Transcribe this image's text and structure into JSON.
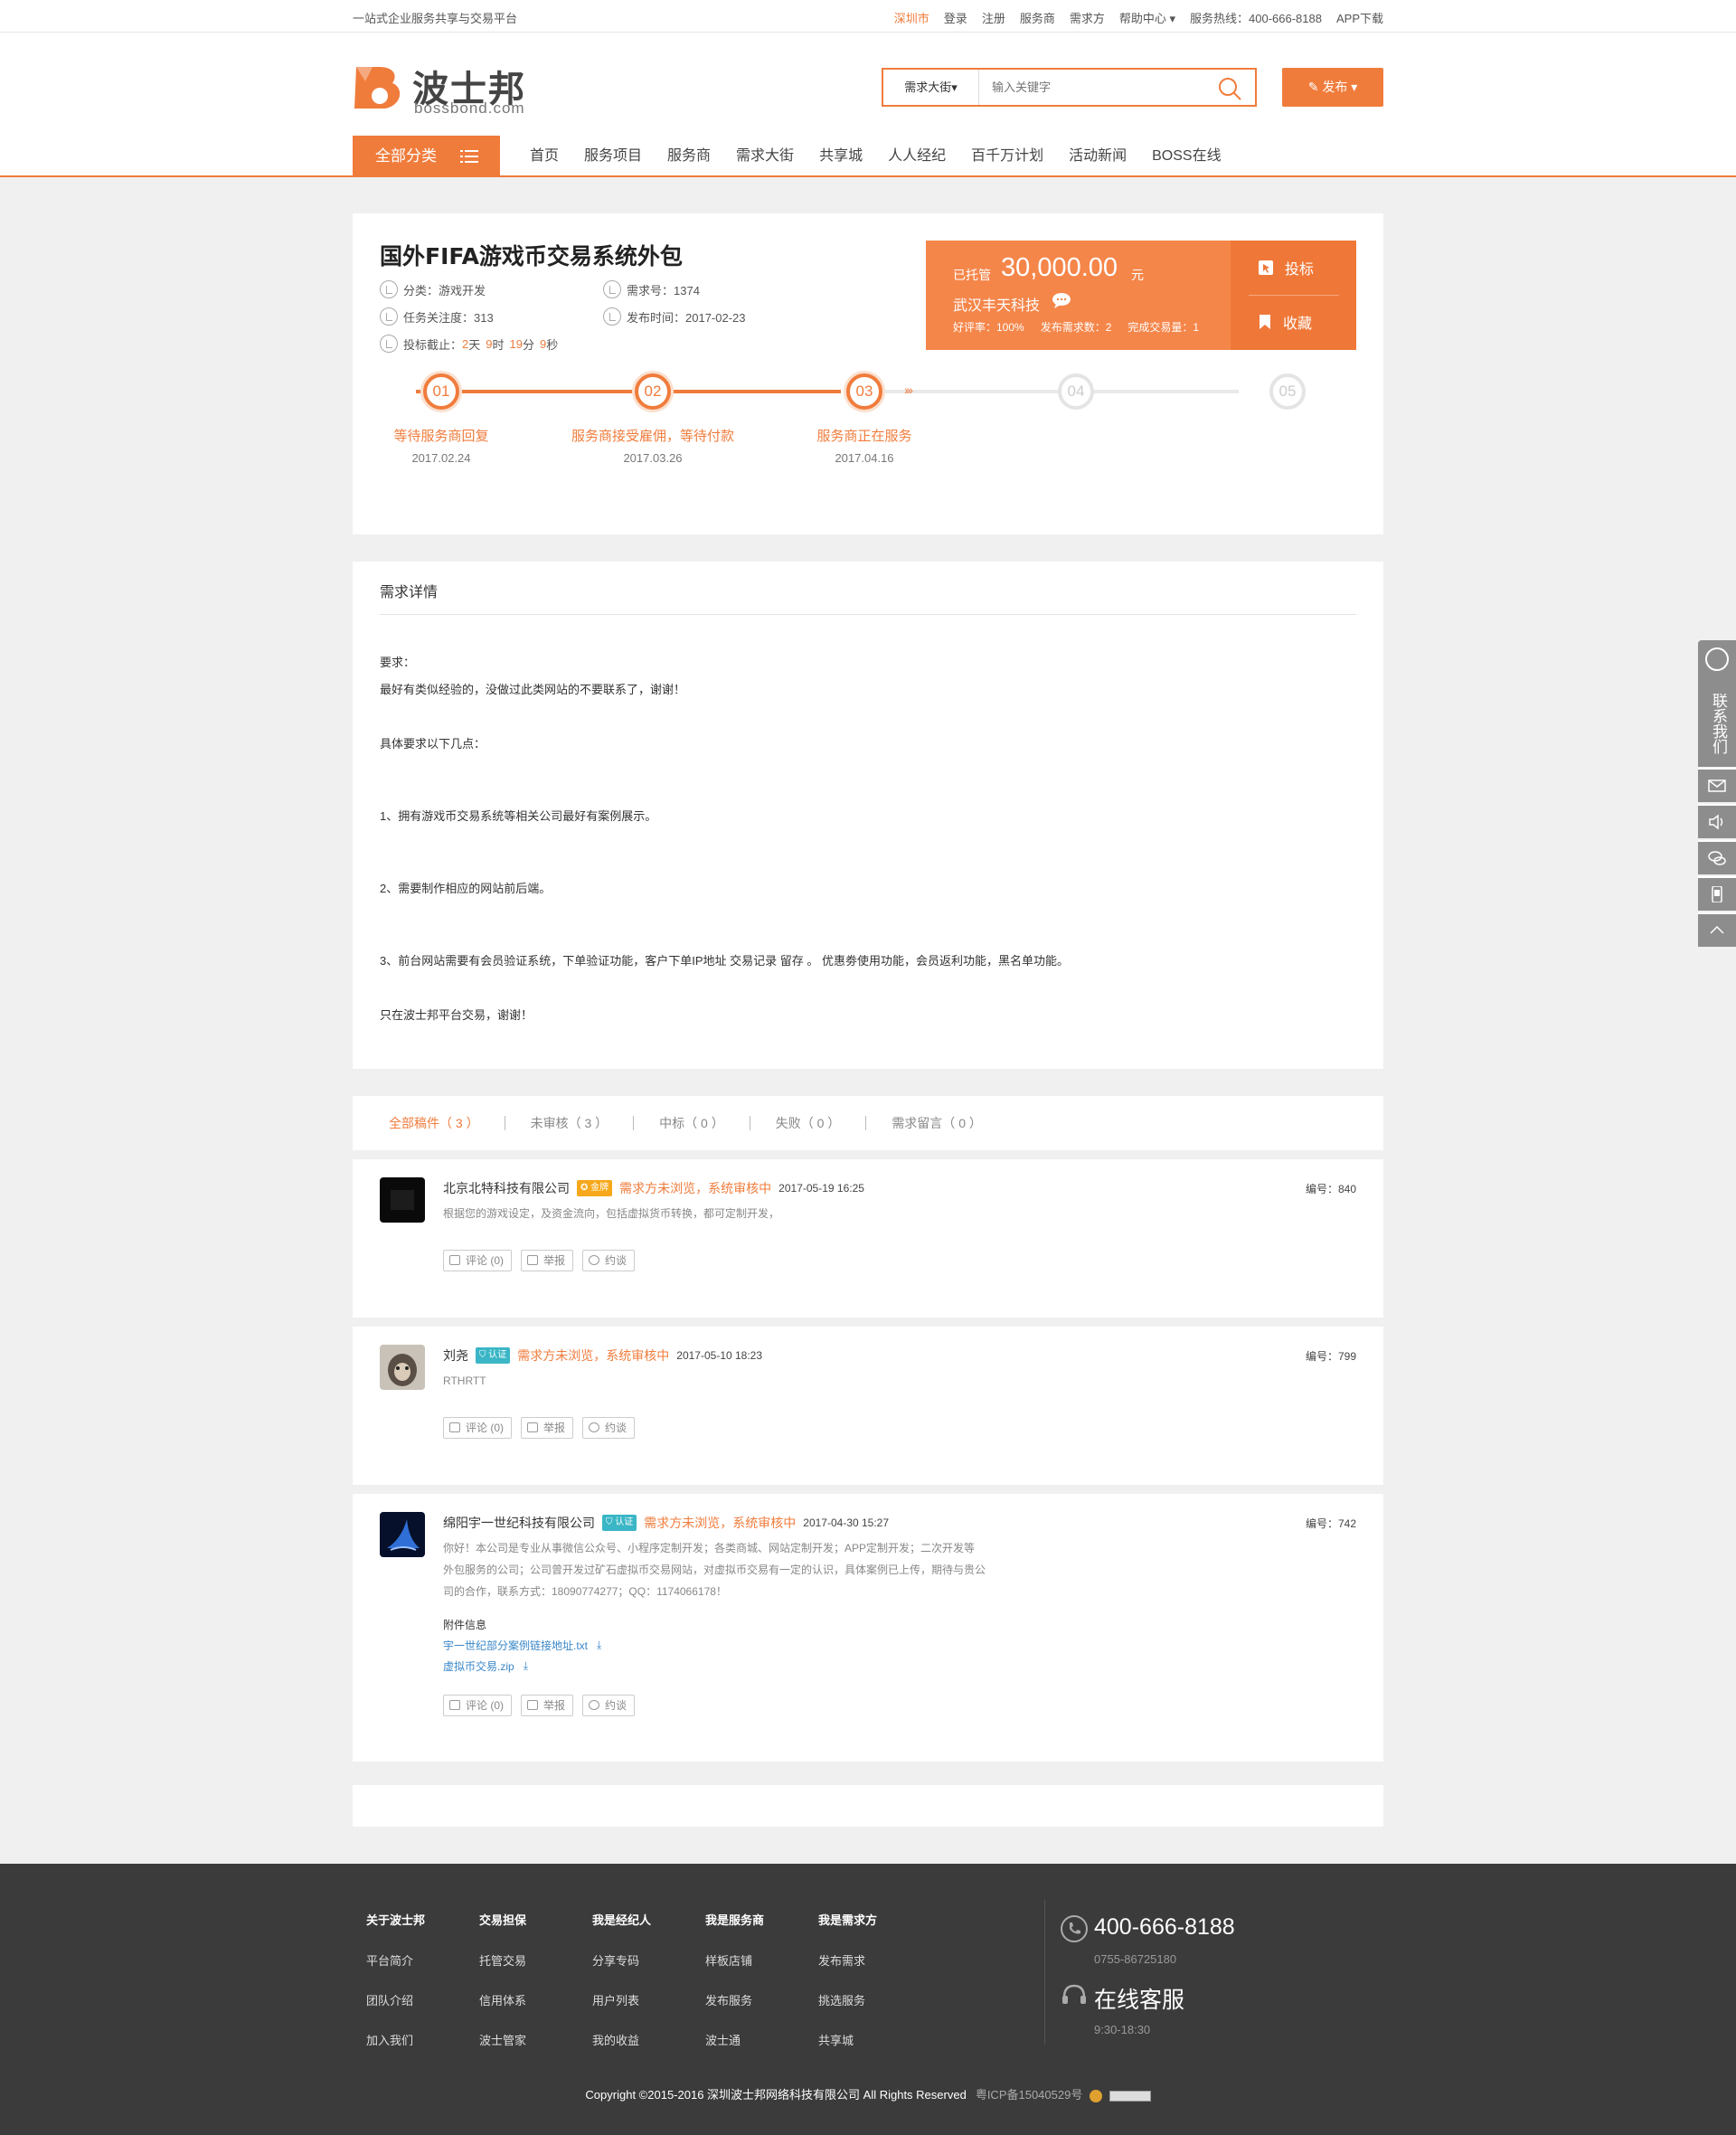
{
  "topbar": {
    "slogan": "一站式企业服务共享与交易平台",
    "city": "深圳市",
    "login": "登录",
    "register": "注册",
    "providers": "服务商",
    "demanders": "需求方",
    "help": "帮助中心",
    "hotline": "服务热线：400-666-8188",
    "app": "APP下载"
  },
  "header": {
    "logo_name": "波士邦",
    "logo_domain": "bossbond.com",
    "search_category": "需求大街",
    "search_placeholder": "输入关键字",
    "publish_label": "发布"
  },
  "nav": {
    "all_label": "全部分类",
    "items": [
      "首页",
      "服务项目",
      "服务商",
      "需求大街",
      "共享城",
      "人人经纪",
      "百千万计划",
      "活动新闻",
      "BOSS在线"
    ]
  },
  "task": {
    "title": "国外FIFA游戏币交易系统外包",
    "category": "分类：游戏开发",
    "demand_no": "需求号：1374",
    "attention": "任务关注度：313",
    "publish_time": "发布时间：2017-02-23",
    "deadline_label": "投标截止：",
    "deadline_days": "2",
    "deadline_days_unit": "天",
    "deadline_hours": "9",
    "deadline_hours_unit": "时",
    "deadline_mins": "19",
    "deadline_mins_unit": "分",
    "deadline_secs": "9",
    "deadline_secs_unit": "秒"
  },
  "price": {
    "label": "已托管",
    "amount": "30,000.00",
    "unit": "元",
    "company": "武汉丰天科技",
    "rating": "好评率：100%",
    "published": "发布需求数：2",
    "completed": "完成交易量：1",
    "bid_label": "投标",
    "favorite_label": "收藏"
  },
  "steps": [
    {
      "num": "01",
      "label": "等待服务商回复",
      "date": "2017.02.24",
      "done": true
    },
    {
      "num": "02",
      "label": "服务商接受雇佣，等待付款",
      "date": "2017.03.26",
      "done": true
    },
    {
      "num": "03",
      "label": "服务商正在服务",
      "date": "2017.04.16",
      "done": true
    },
    {
      "num": "04",
      "label": "",
      "date": "",
      "done": false
    },
    {
      "num": "05",
      "label": "",
      "date": "",
      "done": false
    }
  ],
  "detail": {
    "heading": "需求详情",
    "lines": [
      "要求：",
      "最好有类似经验的，没做过此类网站的不要联系了，谢谢！",
      "具体要求以下几点：",
      "1、拥有游戏币交易系统等相关公司最好有案例展示。",
      "2、需要制作相应的网站前后端。",
      "3、前台网站需要有会员验证系统，下单验证功能，客户下单IP地址 交易记录 留存 。 优惠劵使用功能，会员返利功能，黑名单功能。",
      "只在波士邦平台交易，谢谢！"
    ]
  },
  "tabs": [
    "全部稿件（ 3 ）",
    "未审核（ 3 ）",
    "中标（ 0 ）",
    "失败（ 0 ）",
    "需求留言（ 0 ）"
  ],
  "bids": [
    {
      "name": "北京北特科技有限公司",
      "badge": "金牌",
      "status": "需求方未浏览，系统审核中",
      "time": "2017-05-19 16:25",
      "no": "编号：840",
      "desc": "根据您的游戏设定，及资金流向，包括虚拟货币转换，都可定制开发，"
    },
    {
      "name": "刘尧",
      "badge": "认证",
      "status": "需求方未浏览，系统审核中",
      "time": "2017-05-10 18:23",
      "no": "编号：799",
      "desc": "RTHRTT"
    },
    {
      "name": "绵阳宇一世纪科技有限公司",
      "badge": "认证",
      "status": "需求方未浏览，系统审核中",
      "time": "2017-04-30 15:27",
      "no": "编号：742",
      "desc": "你好！本公司是专业从事微信公众号、小程序定制开发；各类商城、网站定制开发；APP定制开发；二次开发等外包服务的公司；公司曾开发过矿石虚拟币交易网站，对虚拟币交易有一定的认识，具体案例已上传，期待与贵公司的合作，联系方式：18090774277；QQ：1174066178！",
      "attach_label": "附件信息",
      "files": [
        "宇一世纪部分案例链接地址.txt",
        "虚拟币交易.zip"
      ]
    }
  ],
  "bid_buttons": {
    "comment": "评论 (0)",
    "report": "举报",
    "talk": "约谈"
  },
  "sidebar": {
    "contact": "联系我们"
  },
  "footer": {
    "cols": [
      {
        "title": "关于波士邦",
        "items": [
          "平台简介",
          "团队介绍",
          "加入我们"
        ]
      },
      {
        "title": "交易担保",
        "items": [
          "托管交易",
          "信用体系",
          "波士管家"
        ]
      },
      {
        "title": "我是经纪人",
        "items": [
          "分享专码",
          "用户列表",
          "我的收益"
        ]
      },
      {
        "title": "我是服务商",
        "items": [
          "样板店铺",
          "发布服务",
          "波士通"
        ]
      },
      {
        "title": "我是需求方",
        "items": [
          "发布需求",
          "挑选服务",
          "共享城"
        ]
      }
    ],
    "phone": "400-666-8188",
    "phone2": "0755-86725180",
    "service": "在线客服",
    "service_time": "9:30-18:30",
    "copyright": "Copyright ©2015-2016 深圳波士邦网络科技有限公司 All Rights Reserved",
    "icp": "粤ICP备15040529号"
  },
  "colors": {
    "accent": "#f07c3c",
    "footer_bg": "#3b3b3b",
    "link": "#3a87c8",
    "cert": "#3ab6c6",
    "gold": "#f6a81a"
  }
}
